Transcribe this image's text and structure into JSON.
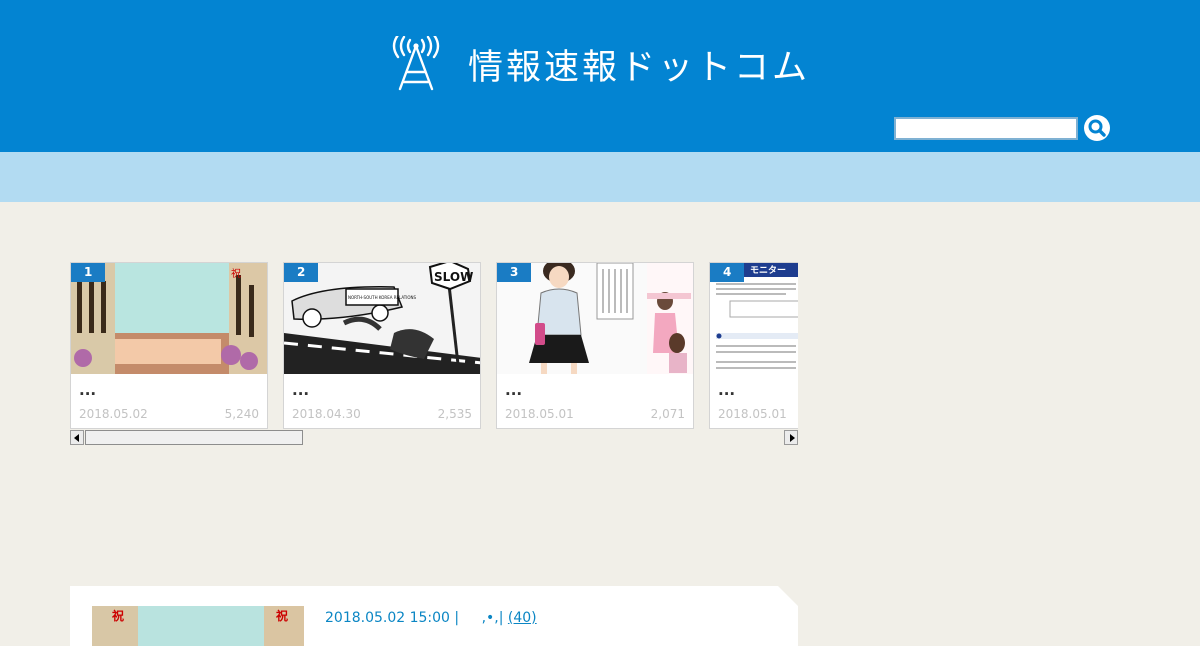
{
  "header": {
    "site_title": "情報速報ドットコム",
    "logo_icon": "antenna-icon",
    "search": {
      "value": "",
      "placeholder": "",
      "button_icon": "search-icon"
    },
    "colors": {
      "header_bg": "#0384d2",
      "nav_bg": "#b2dbf2",
      "page_bg": "#f1efe8"
    }
  },
  "ranking": [
    {
      "rank": "1",
      "title": "...",
      "date": "2018.05.02",
      "views": "5,240"
    },
    {
      "rank": "2",
      "title": "...",
      "date": "2018.04.30",
      "views": "2,535"
    },
    {
      "rank": "3",
      "title": "...",
      "date": "2018.05.01",
      "views": "2,071"
    },
    {
      "rank": "4",
      "title": "...",
      "date": "2018.05.01",
      "views": ""
    }
  ],
  "carousel_thumb_texts": {
    "card1_banner": "祝",
    "card2_sign": "SLOW",
    "card2_car": "NORTH-SOUTH KOREA RELATIONS",
    "card4_banner": "モニター"
  },
  "article": {
    "datetime": "2018.05.02 15:00 |",
    "sep": ",•,|",
    "comments": "(40)",
    "thumb_banner": "祝"
  }
}
